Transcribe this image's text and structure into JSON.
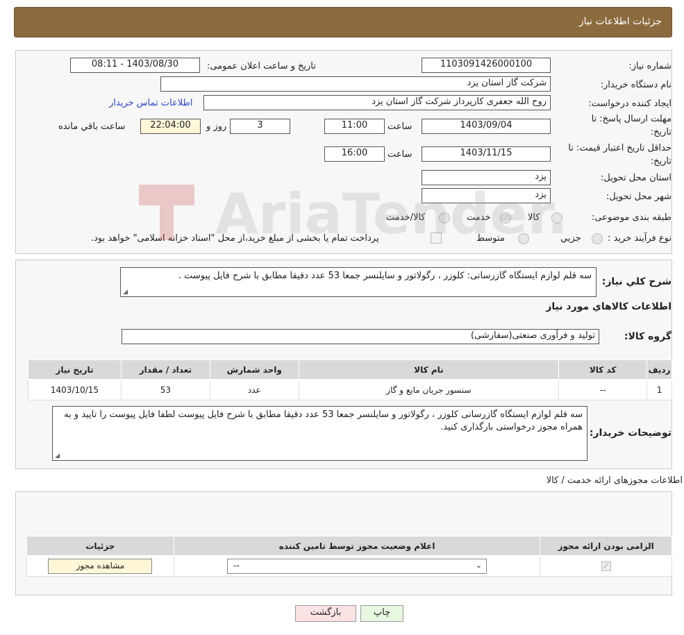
{
  "header": {
    "title": "جزئیات اطلاعات نیاز"
  },
  "form": {
    "need_number_label": "شماره نیاز:",
    "need_number": "1103091426000100",
    "announce_label": "تاریخ و ساعت اعلان عمومی:",
    "announce_value": "1403/08/30 - 08:11",
    "buyer_org_label": "نام دستگاه خریدار:",
    "buyer_org": "شرکت گاز استان یزد",
    "creator_label": "ایجاد کننده درخواست:",
    "creator": "روح الله جعفری کارپرداز شرکت گاز استان یزد",
    "contact_link": "اطلاعات تماس خریدار",
    "deadline_label_1": "مهلت ارسال پاسخ: تا",
    "deadline_label_2": "تاریخ:",
    "deadline_date": "1403/09/04",
    "time_label": "ساعت",
    "deadline_time": "11:00",
    "days_value": "3",
    "days_label": "روز و",
    "remaining_time": "22:04:00",
    "remaining_label": "ساعت باقي مانده",
    "validity_label_1": "حداقل تاریخ اعتبار قیمت: تا",
    "validity_label_2": "تاریخ:",
    "validity_date": "1403/11/15",
    "validity_time": "16:00",
    "province_label": "استان محل تحویل:",
    "province": "یزد",
    "city_label": "شهر محل تحویل:",
    "city": "یزد",
    "category_label": "طبقه بندی موضوعی:",
    "category_options": [
      "کالا",
      "خدمت",
      "کالا/خدمت"
    ],
    "process_label": "نوع فرآیند خرید :",
    "process_options": [
      "جزيي",
      "متوسط"
    ],
    "payment_note": "پرداخت تمام یا بخشی از مبلغ خرید،از محل \"اسناد خزانه اسلامی\" خواهد بود."
  },
  "description": {
    "label": "شرح كلي نياز:",
    "text": "سه قلم لوازم ایستگاه گازرسانی: کلوزر ، رگولاتور و سایلنسر جمعا 53 عدد دقیقا مطابق با شرح فایل پیوست ."
  },
  "goods": {
    "section_title": "اطلاعات كالاهاي مورد نياز",
    "group_label": "گروه کالا:",
    "group_value": "تولید و فرآوری صنعتی(سفارشی)",
    "columns": [
      "رديف",
      "کد کالا",
      "نام کالا",
      "واحد شمارش",
      "تعداد / مقدار",
      "تاریخ نیاز"
    ],
    "rows": [
      [
        "1",
        "--",
        "سنسور جریان مایع و گاز",
        "عدد",
        "53",
        "1403/10/15"
      ]
    ],
    "buyer_notes_label": "توضیحات خریدار:",
    "buyer_notes": "سه قلم لوازم ایستگاه گازرسانی کلوزر ، رگولاتور و سایلنسر جمعا 53 عدد دقیقا مطابق با شرح فایل پیوست لطفا فایل پیوست را تایید و به همراه مجوز درخواستی بارگذاری کنید."
  },
  "permits": {
    "section_title": "اطلاعات مجوزهای ارائه خدمت / کالا",
    "columns": [
      "الزامی بودن ارائه مجوز",
      "اعلام وضعیت مجوز توسط تامین کننده",
      "جزئیات"
    ],
    "select_value": "--",
    "view_button": "مشاهده مجوز"
  },
  "watermark": {
    "text": "AriaTender.neT"
  },
  "buttons": {
    "print": "چاپ",
    "back": "بازگشت"
  },
  "colors": {
    "header": "#8b6a3e",
    "link": "#2a46c8",
    "yellow_field": "#fdf7d8",
    "back_button": "#fbe3e3",
    "print_button": "#e8f7e0"
  }
}
